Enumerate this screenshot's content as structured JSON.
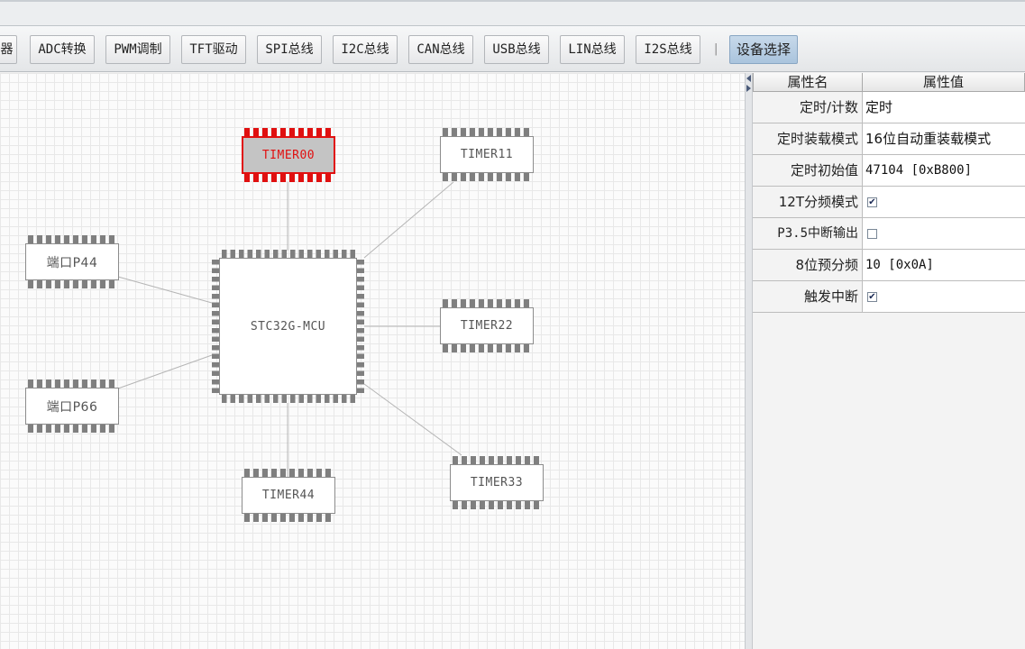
{
  "toolbar": {
    "buttons": [
      {
        "label": "器"
      },
      {
        "label": "ADC转换"
      },
      {
        "label": "PWM调制"
      },
      {
        "label": "TFT驱动"
      },
      {
        "label": "SPI总线"
      },
      {
        "label": "I2C总线"
      },
      {
        "label": "CAN总线"
      },
      {
        "label": "USB总线"
      },
      {
        "label": "LIN总线"
      },
      {
        "label": "I2S总线"
      }
    ],
    "separator": "|",
    "device_select": "设备选择"
  },
  "diagram": {
    "mcu": "STC32G-MCU",
    "timers": [
      "TIMER00",
      "TIMER11",
      "TIMER22",
      "TIMER33",
      "TIMER44"
    ],
    "ports": [
      "端口P44",
      "端口P66"
    ],
    "selected": "TIMER00"
  },
  "properties": {
    "header_name": "属性名",
    "header_value": "属性值",
    "rows": [
      {
        "name": "定时/计数",
        "value": "定时"
      },
      {
        "name": "定时装载模式",
        "value": "16位自动重装载模式"
      },
      {
        "name": "定时初始值",
        "value": "47104 [0xB800]"
      },
      {
        "name": "12T分频模式",
        "checked": true
      },
      {
        "name": "P3.5中断输出",
        "checked": false
      },
      {
        "name": "8位预分频",
        "value": "10 [0x0A]"
      },
      {
        "name": "触发中断",
        "checked": true
      }
    ]
  },
  "colors": {
    "selection": "#e01010",
    "active_button": "#b8cfe5"
  }
}
